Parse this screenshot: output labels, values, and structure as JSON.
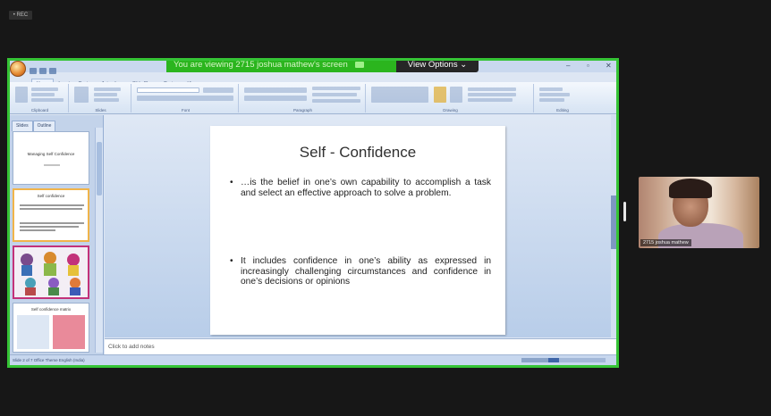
{
  "recording_badge": "• REC",
  "share": {
    "viewing_banner": "You are viewing 2715 joshua mathew's screen",
    "view_options_label": "View Options ⌄"
  },
  "app": {
    "ribbon_tabs": [
      "Home",
      "Insert",
      "Design",
      "Animations",
      "Slide Show",
      "Review",
      "View"
    ],
    "ribbon_groups": [
      "Clipboard",
      "Slides",
      "Font",
      "Paragraph",
      "Drawing",
      "Editing"
    ],
    "pane_tabs": [
      "Slides",
      "Outline"
    ],
    "thumbnails": [
      "Managing Self Confidence",
      "Self confidence",
      "",
      "Self confidence matrix"
    ],
    "window_controls": [
      "–",
      "▫",
      "✕"
    ],
    "notes_placeholder": "Click to add notes",
    "status_text": "Slide 2 of 7   Office Theme   English (India)"
  },
  "slide": {
    "title": "Self - Confidence",
    "bullet_marker": "•",
    "bullets": [
      "…is the belief in one’s own capability to accomplish a task and select an effective approach to solve a problem.",
      "It includes confidence in one’s ability as expressed in increasingly challenging circumstances and confidence in one’s decisions or opinions"
    ]
  },
  "participant": {
    "name": "2715 joshua mathew"
  },
  "colors": {
    "share_border": "#35c435",
    "banner_green": "#2bb51e",
    "background": "#171717"
  }
}
